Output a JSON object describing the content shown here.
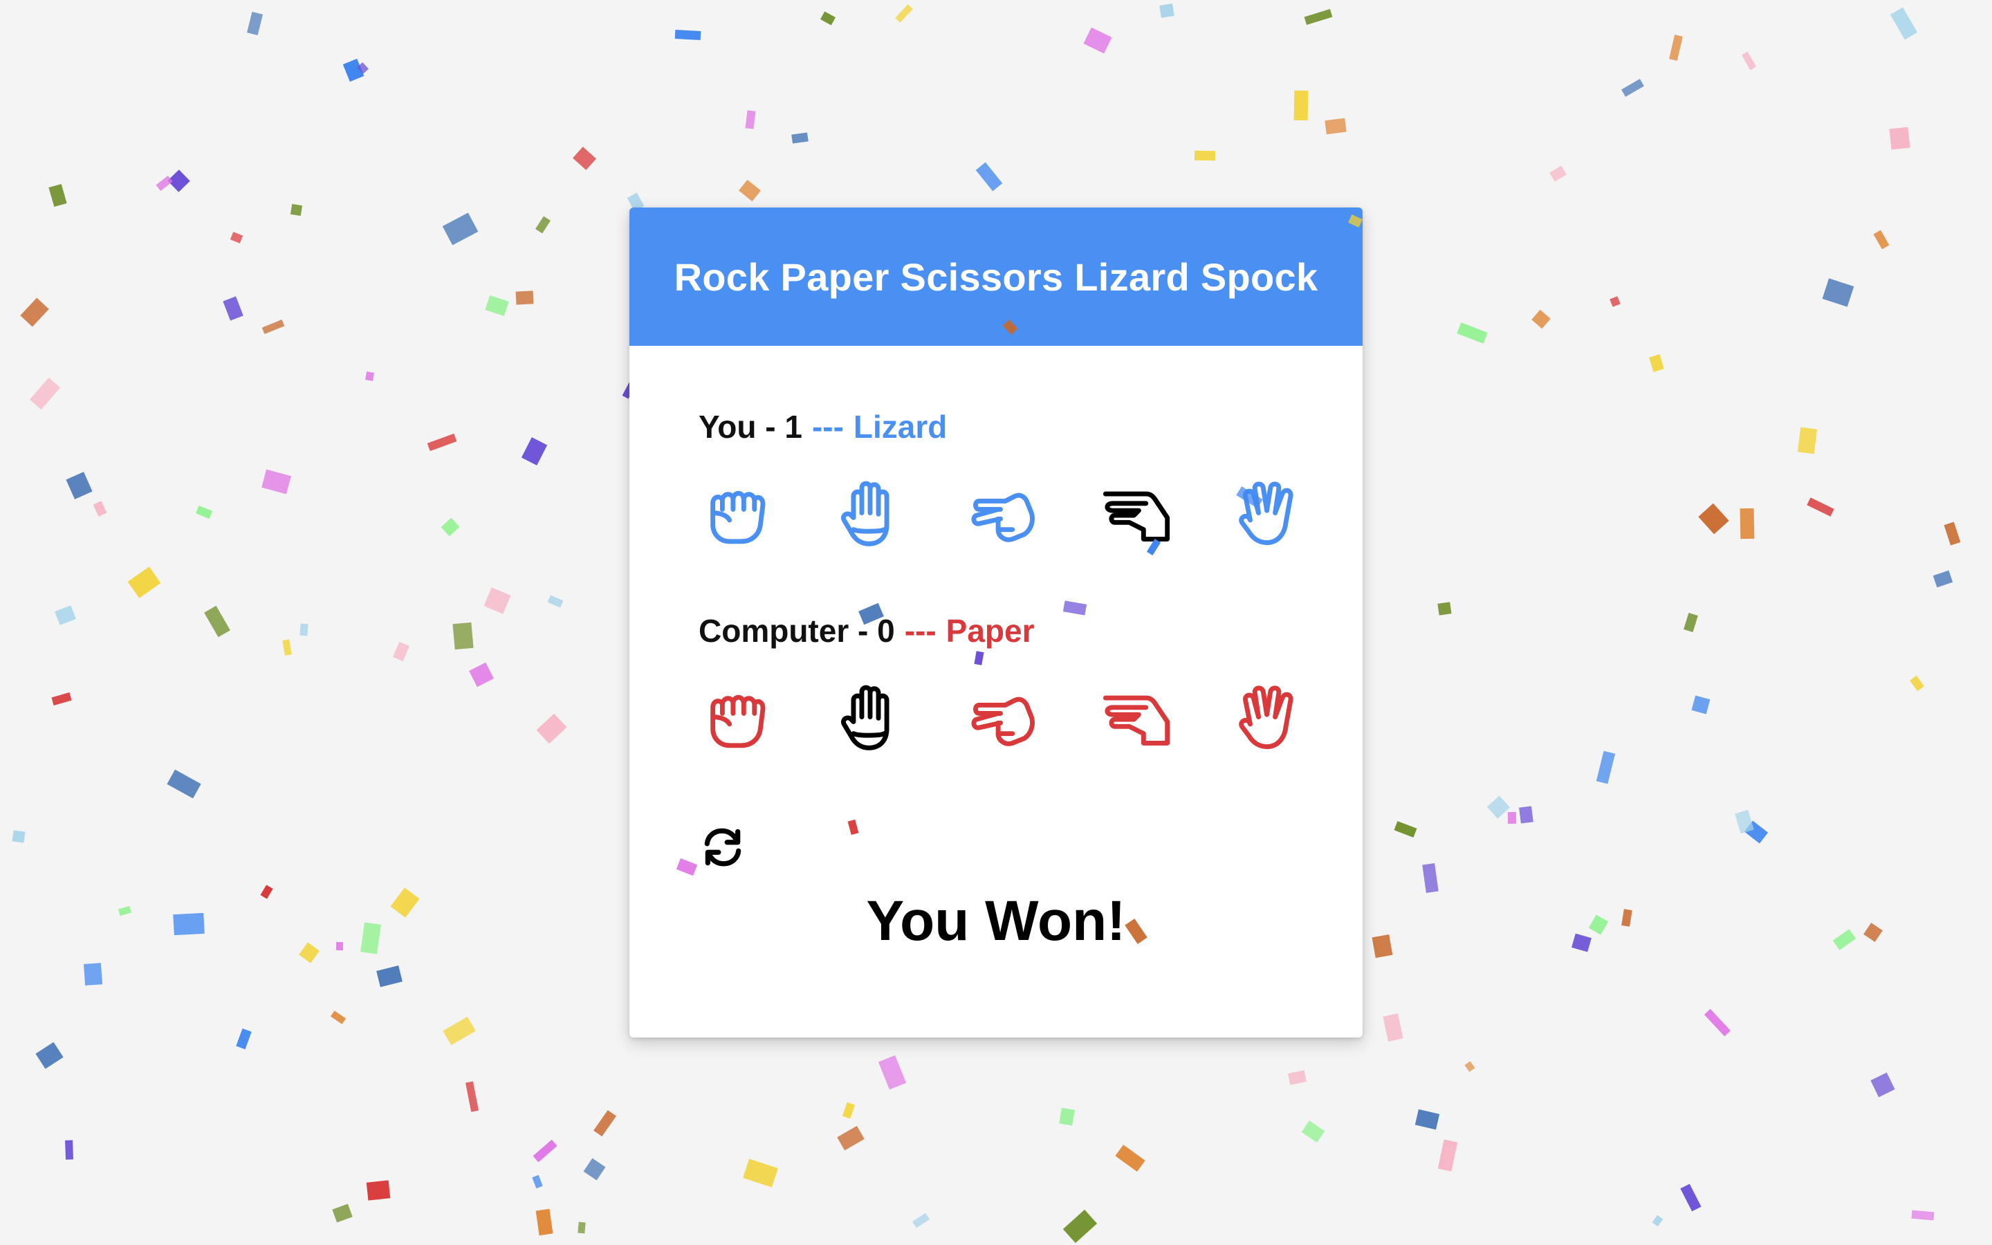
{
  "app": {
    "title": "Rock Paper Scissors Lizard Spock"
  },
  "player": {
    "label": "You - 1",
    "separator": "---",
    "choice": "Lizard",
    "selected": "lizard",
    "color": "#4a8ff2"
  },
  "computer": {
    "label": "Computer - 0",
    "separator": "---",
    "choice": "Paper",
    "selected": "paper",
    "color": "#d9393a"
  },
  "options": [
    {
      "id": "rock",
      "icon": "hand-rock-icon"
    },
    {
      "id": "paper",
      "icon": "hand-paper-icon"
    },
    {
      "id": "scissors",
      "icon": "hand-scissors-icon"
    },
    {
      "id": "lizard",
      "icon": "hand-lizard-icon"
    },
    {
      "id": "spock",
      "icon": "hand-spock-icon"
    }
  ],
  "reset": {
    "icon": "refresh-icon"
  },
  "result": {
    "text": "You Won!"
  },
  "colors": {
    "header": "#4a8ff2",
    "background": "#f4f4f4",
    "confetti": [
      "#6a4fd6",
      "#e078e6",
      "#8ff28f",
      "#3f86ef",
      "#e08a3c",
      "#6f8f2a",
      "#f2d22e",
      "#d9393a",
      "#a8d4ea",
      "#f6b4c4",
      "#4a78b8",
      "#c8672a"
    ]
  }
}
